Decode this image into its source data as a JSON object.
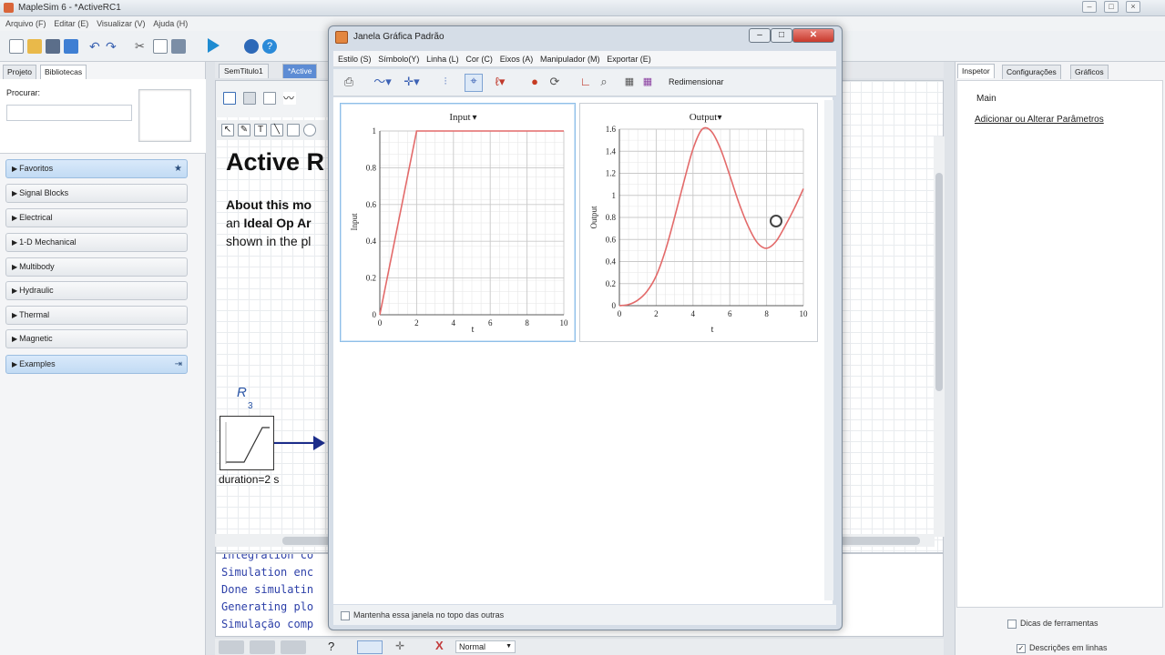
{
  "app": {
    "title": "MapleSim 6 - *ActiveRC1",
    "menu": [
      "Arquivo (F)",
      "Editar (E)",
      "Visualizar (V)",
      "Ajuda (H)"
    ]
  },
  "left_panel": {
    "tabs": [
      "Projeto",
      "Bibliotecas"
    ],
    "search_label": "Procurar:",
    "search_value": "",
    "items": [
      {
        "label": "Favoritos",
        "highlight": true,
        "trailing_icon": "star-icon"
      },
      {
        "label": "Signal Blocks"
      },
      {
        "label": "Electrical"
      },
      {
        "label": "1-D Mechanical"
      },
      {
        "label": "Multibody"
      },
      {
        "label": "Hydraulic"
      },
      {
        "label": "Thermal"
      },
      {
        "label": "Magnetic"
      },
      {
        "label": "Examples",
        "highlight": true,
        "trailing_icon": "expand-icon"
      }
    ]
  },
  "doc": {
    "tabs": [
      "SemTitulo1",
      "*Active"
    ],
    "title": "Active R",
    "body_line1_bold": "About this mo",
    "body_line2_prefix": "an ",
    "body_line2_bold": "Ideal Op Ar",
    "body_line3": "shown in the pl",
    "component_label": "R",
    "component_sub": "3",
    "component_param": "duration=2 s"
  },
  "console": {
    "lines": [
      "Integration co",
      "Simulation enc",
      "Done simulatin",
      "Generating plo",
      "Simulação comp"
    ]
  },
  "bottom_bar": {
    "zoom_label": "Normal"
  },
  "right_panel": {
    "tabs": [
      "Inspetor",
      "Configurações",
      "Gráficos"
    ],
    "main_label": "Main",
    "link": "Adicionar ou Alterar Parâmetros",
    "checkbox_tools": "Dicas de ferramentas",
    "checkbox_desc": "Descrições em linhas"
  },
  "graph_window": {
    "title": "Janela Gráfica Padrão",
    "menu": [
      "Estilo (S)",
      "Símbolo(Y)",
      "Linha (L)",
      "Cor (C)",
      "Eixos (A)",
      "Manipulador (M)",
      "Exportar (E)"
    ],
    "resize_label": "Redimensionar",
    "footer_checkbox": "Mantenha essa janela no topo das outras",
    "colors": {
      "curve": "#e36a6a",
      "grid": "#c9c9c9"
    }
  },
  "chart_data": [
    {
      "type": "line",
      "title": "Input",
      "xlabel": "t",
      "ylabel": "Input",
      "xlim": [
        0,
        10
      ],
      "ylim": [
        0,
        1
      ],
      "xticks": [
        "0",
        "2",
        "4",
        "6",
        "8",
        "10"
      ],
      "yticks": [
        "0",
        "0.2",
        "0.4",
        "0.6",
        "0.8",
        "1"
      ],
      "grid": true,
      "x": [
        0,
        2,
        10
      ],
      "y": [
        0,
        1,
        1
      ]
    },
    {
      "type": "line",
      "title": "Output",
      "xlabel": "t",
      "ylabel": "Output",
      "xlim": [
        0,
        10
      ],
      "ylim": [
        0,
        1.6
      ],
      "xticks": [
        "0",
        "2",
        "4",
        "6",
        "8",
        "10"
      ],
      "yticks": [
        "0",
        "0.2",
        "0.4",
        "0.6",
        "0.8",
        "1",
        "1.2",
        "1.4",
        "1.6"
      ],
      "grid": true,
      "x": [
        0,
        0.5,
        1,
        1.5,
        2,
        2.5,
        3,
        3.5,
        4,
        4.5,
        5,
        5.5,
        6,
        6.5,
        7,
        7.5,
        8,
        8.5,
        9,
        9.5,
        10
      ],
      "y": [
        0,
        0.01,
        0.05,
        0.13,
        0.27,
        0.5,
        0.8,
        1.12,
        1.42,
        1.6,
        1.58,
        1.42,
        1.18,
        0.93,
        0.72,
        0.57,
        0.52,
        0.58,
        0.72,
        0.88,
        1.06
      ]
    }
  ]
}
